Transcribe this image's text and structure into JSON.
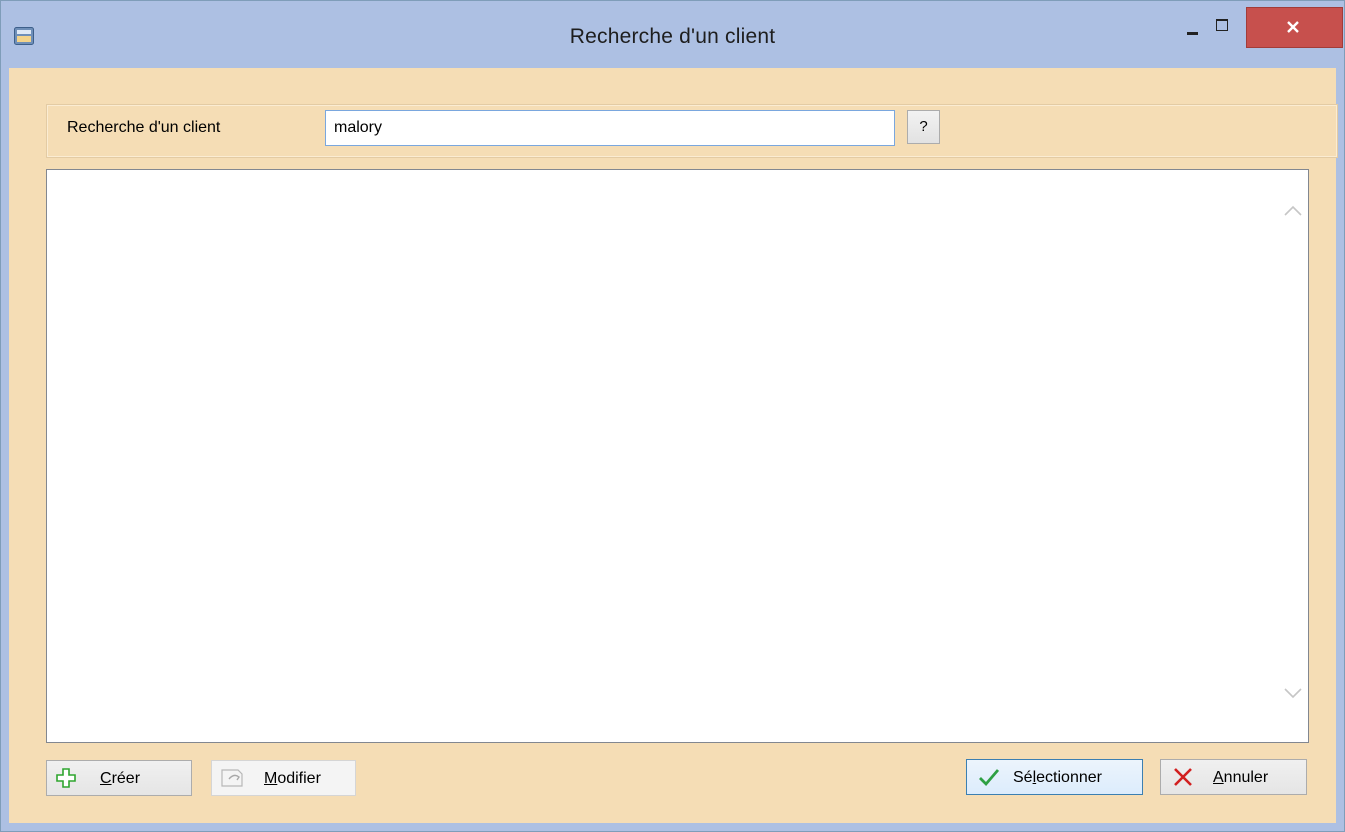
{
  "window": {
    "title": "Recherche d'un client"
  },
  "search": {
    "label": "Recherche d'un client",
    "value": "malory",
    "help_label": "?"
  },
  "list": {
    "items": []
  },
  "buttons": {
    "create": {
      "prefix": "",
      "mnemonic": "C",
      "rest": "réer",
      "icon": "plus-icon"
    },
    "modify": {
      "prefix": "",
      "mnemonic": "M",
      "rest": "odifier",
      "icon": "edit-icon"
    },
    "select": {
      "prefix": "Sé",
      "mnemonic": "l",
      "rest": "ectionner",
      "icon": "check-icon"
    },
    "cancel": {
      "prefix": "",
      "mnemonic": "A",
      "rest": "nnuler",
      "icon": "cross-icon"
    }
  },
  "colors": {
    "titlebar": "#adc0e3",
    "client_background": "#f5ddb5",
    "close_button": "#c7504d",
    "check_green": "#2ea043",
    "cross_red": "#d21f1f"
  }
}
